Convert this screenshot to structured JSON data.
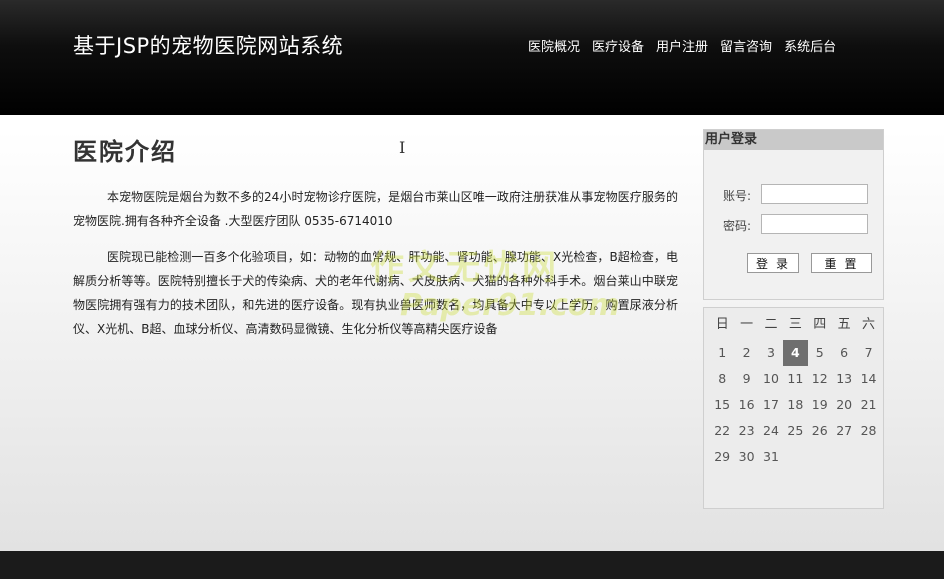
{
  "header": {
    "site_title": "基于JSP的宠物医院网站系统",
    "nav": [
      "医院概况",
      "医疗设备",
      "用户注册",
      "留言咨询",
      "系统后台"
    ]
  },
  "main": {
    "title": "医院介绍",
    "paragraphs": [
      "本宠物医院是烟台为数不多的24小时宠物诊疗医院，是烟台市莱山区唯一政府注册获准从事宠物医疗服务的宠物医院.拥有各种齐全设备 .大型医疗团队 0535-6714010",
      "医院现已能检测一百多个化验项目，如：动物的血常规、肝功能、肾功能、腺功能、X光检查，B超检查，电解质分析等等。医院特别擅长于犬的传染病、犬的老年代谢病、犬皮肤病、犬猫的各种外科手术。烟台莱山中联宠物医院拥有强有力的技术团队，和先进的医疗设备。现有执业兽医师数名，均具备大中专以上学历。购置尿液分析仪、X光机、B超、血球分析仪、高清数码显微镜、生化分析仪等高精尖医疗设备"
    ]
  },
  "login": {
    "title": "用户登录",
    "account_label": "账号:",
    "password_label": "密码:",
    "account_value": "",
    "password_value": "",
    "login_button": "登录",
    "reset_button": "重置"
  },
  "calendar": {
    "weekdays": [
      "日",
      "一",
      "二",
      "三",
      "四",
      "五",
      "六"
    ],
    "weeks": [
      [
        "1",
        "2",
        "3",
        "4",
        "5",
        "6",
        "7"
      ],
      [
        "8",
        "9",
        "10",
        "11",
        "12",
        "13",
        "14"
      ],
      [
        "15",
        "16",
        "17",
        "18",
        "19",
        "20",
        "21"
      ],
      [
        "22",
        "23",
        "24",
        "25",
        "26",
        "27",
        "28"
      ],
      [
        "29",
        "30",
        "31",
        "",
        "",
        "",
        ""
      ]
    ],
    "today": "4"
  },
  "watermark": {
    "line1": "作文无忧网",
    "line2": "Paper91.com"
  }
}
